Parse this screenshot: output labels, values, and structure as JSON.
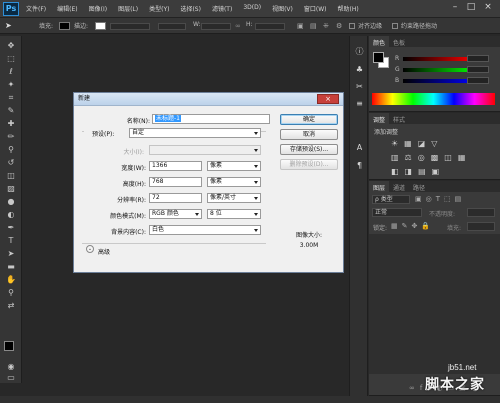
{
  "app": {
    "logo": "Ps"
  },
  "menu": [
    "文件(F)",
    "编辑(E)",
    "图像(I)",
    "图层(L)",
    "类型(Y)",
    "选择(S)",
    "滤镜(T)",
    "3D(D)",
    "视图(V)",
    "窗口(W)",
    "帮助(H)"
  ],
  "window_controls": {
    "minimize": "–",
    "maximize": "□",
    "close": "×"
  },
  "options": {
    "fill_label": "填充:",
    "stroke_label": "描边:",
    "w_label": "W:",
    "h_label": "H:",
    "align_edges": "对齐边缘",
    "constrain": "约束路径拖动",
    "fill_color": "#000000"
  },
  "panels": {
    "color": {
      "tabs": [
        "颜色",
        "色板"
      ],
      "r": "R",
      "g": "G",
      "b": "B",
      "fg": "#000000",
      "bg": "#ffffff"
    },
    "adjustments": {
      "tabs": [
        "调整",
        "样式"
      ],
      "hint": "添加调整"
    },
    "layers": {
      "tabs": [
        "图层",
        "通道",
        "路径"
      ],
      "kind": "ρ 类型",
      "mode": "正常",
      "opacity_label": "不透明度:",
      "lock_label": "锁定:",
      "fill_label": "填充:"
    }
  },
  "dialog": {
    "title": "新建",
    "close": "×",
    "name_label": "名称(N):",
    "name_value": "未标题-1",
    "preset_label": "预设(P):",
    "preset_value": "自定",
    "size_label": "大小(I):",
    "width_label": "宽度(W):",
    "width_value": "1366",
    "width_unit": "像素",
    "height_label": "高度(H):",
    "height_value": "768",
    "height_unit": "像素",
    "resolution_label": "分辨率(R):",
    "resolution_value": "72",
    "resolution_unit": "像素/英寸",
    "colormode_label": "颜色模式(M):",
    "colormode_value": "RGB 颜色",
    "bitdepth_value": "8 位",
    "background_label": "背景内容(C):",
    "background_value": "白色",
    "advanced_label": "高级",
    "ok": "确定",
    "cancel": "取消",
    "save_preset": "存储预设(S)...",
    "delete_preset": "删除预设(D)...",
    "image_size_label": "图像大小:",
    "image_size_value": "3.00M"
  },
  "watermark": {
    "site": "jb51.net",
    "brand": "脚本之家"
  }
}
